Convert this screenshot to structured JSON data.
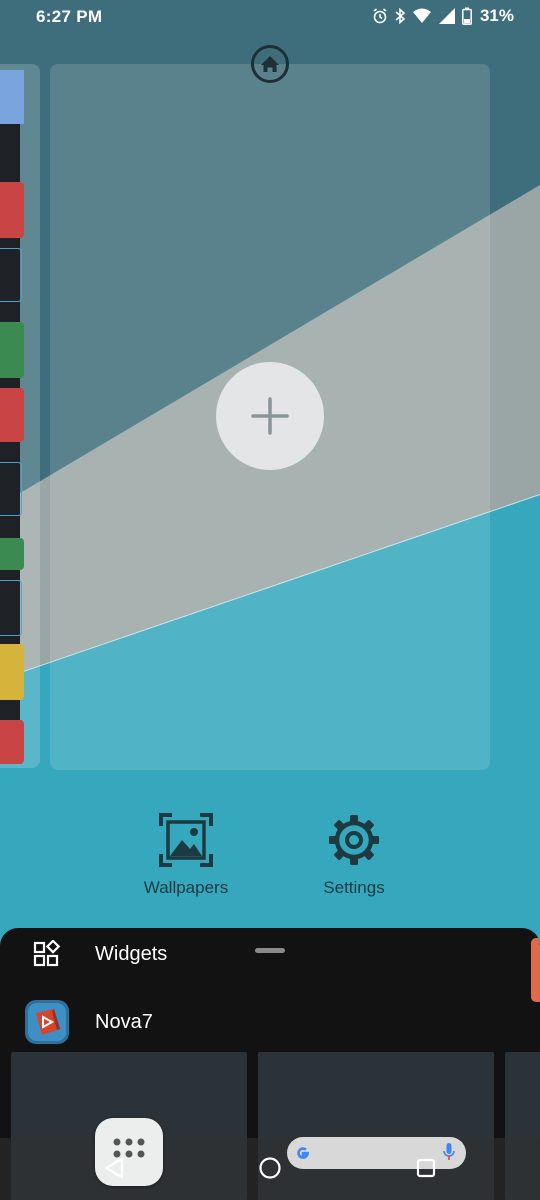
{
  "status_bar": {
    "time": "6:27 PM",
    "battery_percent": "31%",
    "icons": [
      "alarm-icon",
      "bluetooth-icon",
      "wifi-icon",
      "cell-signal-icon",
      "battery-icon"
    ]
  },
  "editor": {
    "home_indicator_icon": "home-icon",
    "add_page_icon": "plus-icon"
  },
  "actions": {
    "wallpapers_label": "Wallpapers",
    "settings_label": "Settings"
  },
  "sheet": {
    "widgets_label": "Widgets",
    "nova_label": "Nova7"
  },
  "colors": {
    "accent_teal": "#35a8bd",
    "sheet_bg": "#121212",
    "scrollbar": "#e0694a",
    "icon_dark": "#1d3942"
  }
}
